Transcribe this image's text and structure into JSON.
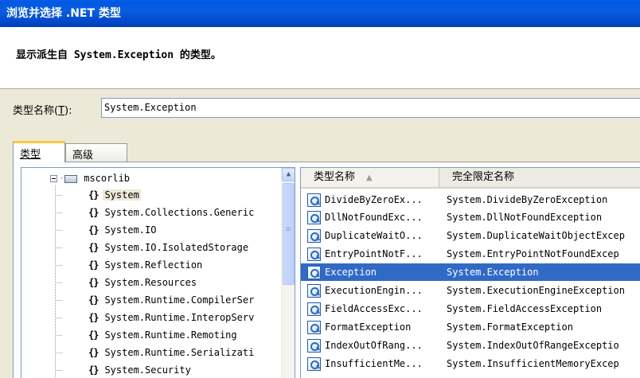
{
  "window": {
    "title": "浏览并选择 .NET 类型"
  },
  "header": {
    "description": "显示派生自 System.Exception 的类型。"
  },
  "type_name": {
    "label_pre": "类型名称(",
    "label_key": "T",
    "label_post": "):",
    "value": "System.Exception"
  },
  "tabs": [
    {
      "label": "类型"
    },
    {
      "label": "高级"
    }
  ],
  "tree": {
    "root": "mscorlib",
    "items": [
      {
        "label": "System"
      },
      {
        "label": "System.Collections.Generic"
      },
      {
        "label": "System.IO"
      },
      {
        "label": "System.IO.IsolatedStorage"
      },
      {
        "label": "System.Reflection"
      },
      {
        "label": "System.Resources"
      },
      {
        "label": "System.Runtime.CompilerSer"
      },
      {
        "label": "System.Runtime.InteropServ"
      },
      {
        "label": "System.Runtime.Remoting"
      },
      {
        "label": "System.Runtime.Serializati"
      },
      {
        "label": "System.Security"
      }
    ],
    "namespace_icon": "{}"
  },
  "list": {
    "columns": {
      "type_name": "类型名称",
      "full_name": "完全限定名称"
    },
    "rows": [
      {
        "name": "DivideByZeroEx...",
        "full": "System.DivideByZeroException"
      },
      {
        "name": "DllNotFoundExc...",
        "full": "System.DllNotFoundException"
      },
      {
        "name": "DuplicateWaitO...",
        "full": "System.DuplicateWaitObjectExcep"
      },
      {
        "name": "EntryPointNotF...",
        "full": "System.EntryPointNotFoundExcep"
      },
      {
        "name": "Exception",
        "full": "System.Exception"
      },
      {
        "name": "ExecutionEngin...",
        "full": "System.ExecutionEngineException"
      },
      {
        "name": "FieldAccessExc...",
        "full": "System.FieldAccessException"
      },
      {
        "name": "FormatException",
        "full": "System.FormatException"
      },
      {
        "name": "IndexOutOfRang...",
        "full": "System.IndexOutOfRangeExceptio"
      },
      {
        "name": "InsufficientMe...",
        "full": "System.InsufficientMemoryExcep"
      }
    ]
  },
  "colors": {
    "titlebar": "#0054E3",
    "selection": "#316AC5",
    "tab_highlight": "#FFC83C"
  }
}
